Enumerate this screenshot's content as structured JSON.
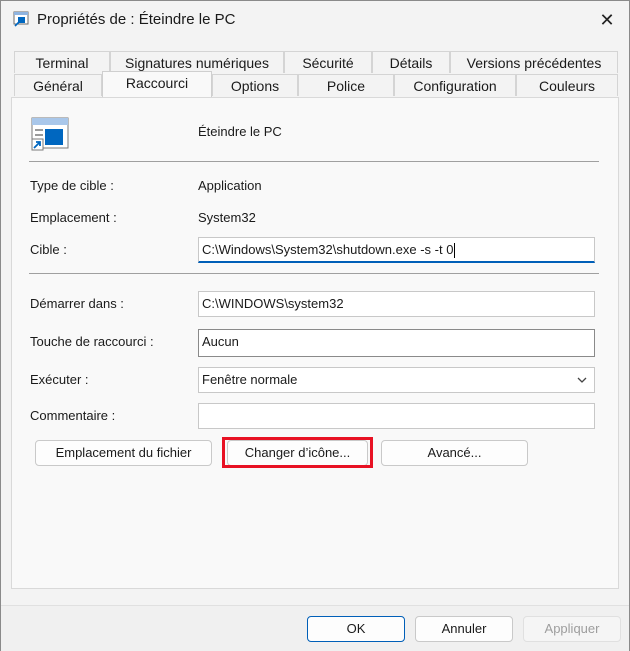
{
  "window": {
    "title": "Propriétés de : Éteindre le PC",
    "close_glyph": "✕"
  },
  "tabs": {
    "row1": [
      "Terminal",
      "Signatures numériques",
      "Sécurité",
      "Détails",
      "Versions précédentes"
    ],
    "row2": [
      "Général",
      "Raccourci",
      "Options",
      "Police",
      "Configuration",
      "Couleurs"
    ],
    "active": "Raccourci"
  },
  "shortcut": {
    "name": "Éteindre le PC",
    "target_type_label": "Type de cible :",
    "target_type_value": "Application",
    "location_label": "Emplacement :",
    "location_value": "System32",
    "target_label": "Cible :",
    "target_value": "C:\\Windows\\System32\\shutdown.exe -s -t 0",
    "start_in_label": "Démarrer dans :",
    "start_in_value": "C:\\WINDOWS\\system32",
    "hotkey_label": "Touche de raccourci :",
    "hotkey_value": "Aucun",
    "run_label": "Exécuter :",
    "run_value": "Fenêtre normale",
    "comment_label": "Commentaire :",
    "comment_value": ""
  },
  "actions": {
    "open_location": "Emplacement du fichier",
    "change_icon": "Changer d’icône...",
    "advanced": "Avancé..."
  },
  "footer": {
    "ok": "OK",
    "cancel": "Annuler",
    "apply": "Appliquer"
  },
  "colors": {
    "accent": "#005fb8",
    "highlight": "#e81123"
  },
  "icons": {
    "app": "shortcut-window-icon",
    "close": "close-icon",
    "dropdown": "chevron-down-icon"
  }
}
